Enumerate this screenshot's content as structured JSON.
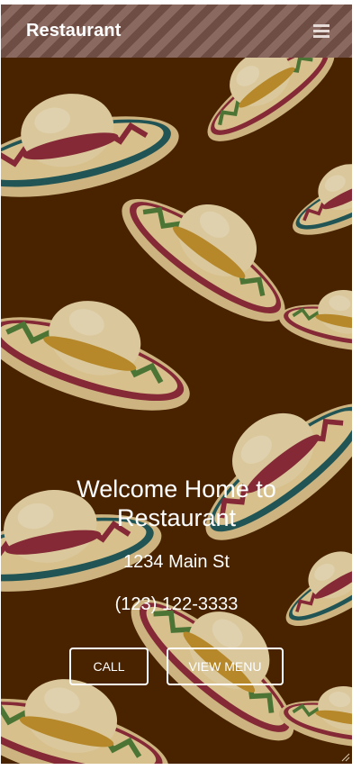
{
  "header": {
    "brand": "Restaurant",
    "menu_icon": "hamburger-menu-icon"
  },
  "hero": {
    "title": "Welcome Home to Restaurant",
    "address": "1234 Main St",
    "phone": "(123) 122-3333",
    "call_label": "CALL",
    "view_menu_label": "VIEW MENU",
    "background_pattern": "sombrero-pattern"
  },
  "colors": {
    "background": "#4a2400",
    "header_stripe_dark": "#6e4d45",
    "header_stripe_light": "#8a6a60",
    "text": "#ffffff"
  }
}
